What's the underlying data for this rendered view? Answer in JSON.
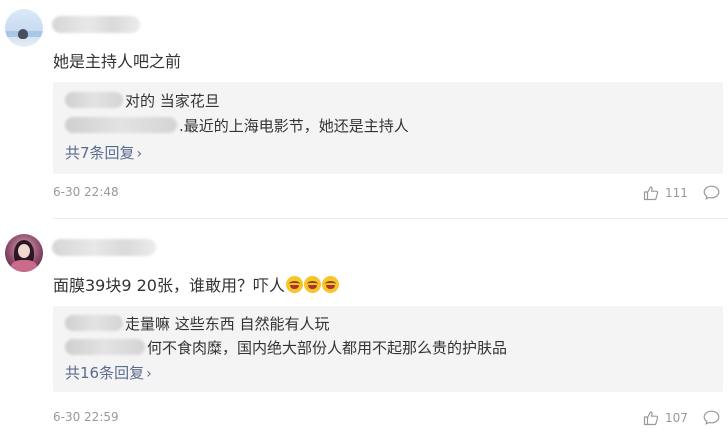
{
  "comments": [
    {
      "text": "她是主持人吧之前",
      "replies": [
        {
          "text": "对的 当家花旦"
        },
        {
          "text": ".最近的上海电影节，她还是主持人"
        }
      ],
      "reply_count": "共7条回复",
      "time": "6-30 22:48",
      "likes": "111"
    },
    {
      "text": "面膜39块9 20张，谁敢用？吓人",
      "replies": [
        {
          "text": "走量嘛 这些东西 自然能有人玩"
        },
        {
          "text": "何不食肉糜，国内绝大部份人都用不起那么贵的护肤品"
        }
      ],
      "reply_count": "共16条回复",
      "time": "6-30 22:59",
      "likes": "107"
    }
  ],
  "icons": {
    "like": "thumbs-up-icon",
    "comment": "comment-bubble-icon",
    "chevron": "chevron-right-icon",
    "emoji": "laughing-emoji-icon"
  }
}
